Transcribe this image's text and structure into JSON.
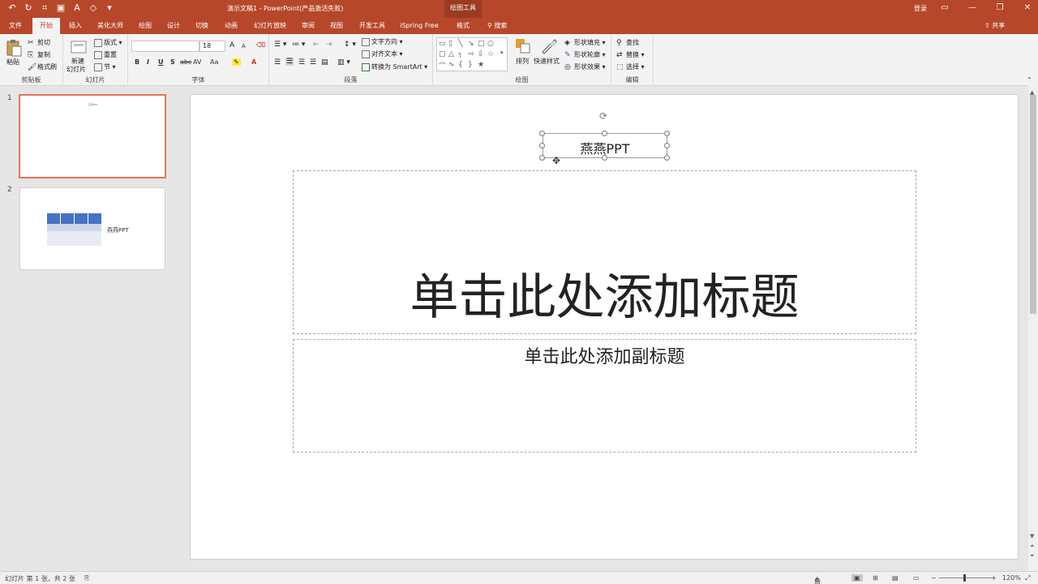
{
  "window": {
    "title": "演示文稿1  -  PowerPoint(产品激活失败)",
    "context_tab_group": "绘图工具",
    "login": "登录",
    "share": "共享",
    "search": "搜索"
  },
  "tabs": [
    "文件",
    "开始",
    "插入",
    "美化大师",
    "绘图",
    "设计",
    "切换",
    "动画",
    "幻灯片放映",
    "审阅",
    "视图",
    "开发工具",
    "iSpring Free",
    "格式"
  ],
  "active_tab": "开始",
  "ribbon": {
    "clipboard": {
      "label": "剪贴板",
      "paste": "粘贴",
      "cut": "剪切",
      "copy": "复制",
      "format_painter": "格式刷"
    },
    "slides": {
      "label": "幻灯片",
      "new_slide_1": "新建",
      "new_slide_2": "幻灯片",
      "layout": "版式",
      "reset": "重置",
      "section": "节"
    },
    "font": {
      "label": "字体",
      "font_name": "",
      "font_size": "18",
      "bold": "B",
      "italic": "I",
      "underline": "U",
      "shadow": "S",
      "strike": "abc",
      "spacing": "AV",
      "case": "Aa",
      "grow": "A",
      "shrink": "A",
      "color": "A"
    },
    "paragraph": {
      "label": "段落",
      "text_direction": "文字方向",
      "align_text": "对齐文本",
      "smartart": "转换为 SmartArt"
    },
    "drawing": {
      "label": "绘图",
      "arrange": "排列",
      "quick_styles": "快速样式",
      "shape_fill": "形状填充",
      "shape_outline": "形状轮廓",
      "shape_effects": "形状效果"
    },
    "editing": {
      "label": "编辑",
      "find": "查找",
      "replace": "替换",
      "select": "选择"
    }
  },
  "thumbnails": [
    {
      "number": "1",
      "text": "燕燕PPT"
    },
    {
      "number": "2",
      "text": "燕燕PPT"
    }
  ],
  "slide": {
    "textbox": "燕燕PPT",
    "title_placeholder": "单击此处添加标题",
    "subtitle_placeholder": "单击此处添加副标题"
  },
  "status": {
    "slide_info": "幻灯片 第 1 张，共 2 张",
    "notes": "备注",
    "zoom": "120%"
  },
  "colors": {
    "accent": "#b7472a",
    "selection_border": "#e2765a"
  }
}
